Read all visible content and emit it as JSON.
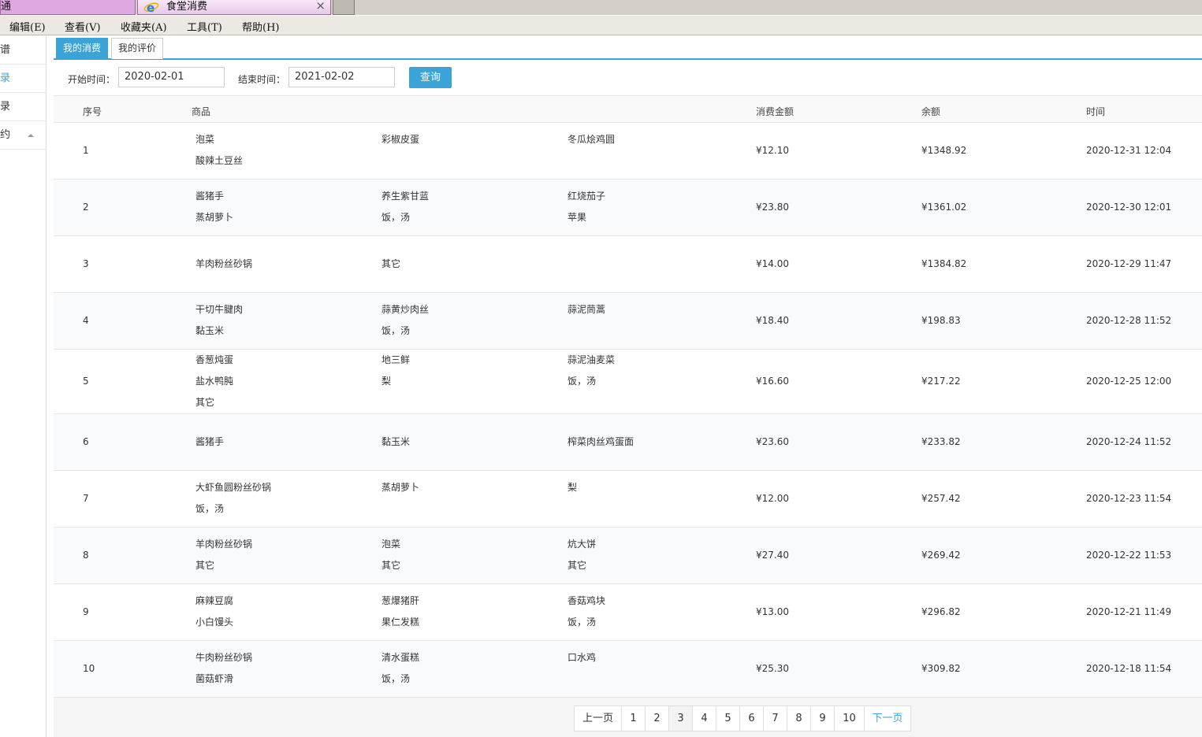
{
  "browser": {
    "tabs": [
      {
        "label": "交通"
      },
      {
        "label": "食堂消费"
      }
    ],
    "close_glyph": "×",
    "menu": [
      "编辑(E)",
      "查看(V)",
      "收藏夹(A)",
      "工具(T)",
      "帮助(H)"
    ]
  },
  "sidebar": {
    "items": [
      {
        "label": "菜谱"
      },
      {
        "label": "记录"
      },
      {
        "label": "记录"
      },
      {
        "label": "预约"
      }
    ]
  },
  "content": {
    "tabs": [
      "我的消费",
      "我的评价"
    ],
    "filter": {
      "start_label": "开始时间：",
      "start_value": "2020-02-01",
      "end_label": "结束时间：",
      "end_value": "2021-02-02",
      "query_label": "查询"
    },
    "columns": [
      "序号",
      "商品",
      "消费金额",
      "余额",
      "时间"
    ],
    "rows": [
      {
        "no": "1",
        "items": [
          [
            "泡菜",
            "酸辣土豆丝"
          ],
          [
            "彩椒皮蛋"
          ],
          [
            "冬瓜烩鸡圆"
          ]
        ],
        "amount": "¥12.10",
        "balance": "¥1348.92",
        "time": "2020-12-31 12:04"
      },
      {
        "no": "2",
        "items": [
          [
            "酱猪手",
            "蒸胡萝卜"
          ],
          [
            "养生紫甘蓝",
            "饭，汤"
          ],
          [
            "红烧茄子",
            "苹果"
          ]
        ],
        "amount": "¥23.80",
        "balance": "¥1361.02",
        "time": "2020-12-30 12:01"
      },
      {
        "no": "3",
        "items": [
          [
            "羊肉粉丝砂锅"
          ],
          [
            "其它"
          ],
          []
        ],
        "amount": "¥14.00",
        "balance": "¥1384.82",
        "time": "2020-12-29 11:47"
      },
      {
        "no": "4",
        "items": [
          [
            "干切牛腱肉",
            "黏玉米"
          ],
          [
            "蒜黄炒肉丝",
            "饭，汤"
          ],
          [
            "蒜泥茼蒿"
          ]
        ],
        "amount": "¥18.40",
        "balance": "¥198.83",
        "time": "2020-12-28 11:52"
      },
      {
        "no": "5",
        "items": [
          [
            "香葱炖蛋",
            "盐水鸭肫",
            "其它"
          ],
          [
            "地三鲜",
            "梨"
          ],
          [
            "蒜泥油麦菜",
            "饭，汤"
          ]
        ],
        "amount": "¥16.60",
        "balance": "¥217.22",
        "time": "2020-12-25 12:00"
      },
      {
        "no": "6",
        "items": [
          [
            "酱猪手"
          ],
          [
            "黏玉米"
          ],
          [
            "榨菜肉丝鸡蛋面"
          ]
        ],
        "amount": "¥23.60",
        "balance": "¥233.82",
        "time": "2020-12-24 11:52"
      },
      {
        "no": "7",
        "items": [
          [
            "大虾鱼圆粉丝砂锅",
            "饭，汤"
          ],
          [
            "蒸胡萝卜"
          ],
          [
            "梨"
          ]
        ],
        "amount": "¥12.00",
        "balance": "¥257.42",
        "time": "2020-12-23 11:54"
      },
      {
        "no": "8",
        "items": [
          [
            "羊肉粉丝砂锅",
            "其它"
          ],
          [
            "泡菜",
            "其它"
          ],
          [
            "炕大饼",
            "其它"
          ]
        ],
        "amount": "¥27.40",
        "balance": "¥269.42",
        "time": "2020-12-22 11:53"
      },
      {
        "no": "9",
        "items": [
          [
            "麻辣豆腐",
            "小白馒头"
          ],
          [
            "葱爆猪肝",
            "果仁发糕"
          ],
          [
            "香菇鸡块",
            "饭，汤"
          ]
        ],
        "amount": "¥13.00",
        "balance": "¥296.82",
        "time": "2020-12-21 11:49"
      },
      {
        "no": "10",
        "items": [
          [
            "牛肉粉丝砂锅",
            "菌菇虾滑"
          ],
          [
            "清水蛋糕",
            "饭，汤"
          ],
          [
            "口水鸡"
          ]
        ],
        "amount": "¥25.30",
        "balance": "¥309.82",
        "time": "2020-12-18 11:54"
      }
    ],
    "pagination": {
      "prev": "上一页",
      "pages": [
        "1",
        "2",
        "3",
        "4",
        "5",
        "6",
        "7",
        "8",
        "9",
        "10"
      ],
      "current": "3",
      "next": "下一页"
    }
  },
  "colors": {
    "accent": "#3aa3d8",
    "row_alt": "#f9fafc",
    "tab_pink": "#e0a8e0"
  },
  "icons": {
    "browser_tab_icon": "ie-logo-icon",
    "sidebar_caret": "caret-up-icon"
  }
}
